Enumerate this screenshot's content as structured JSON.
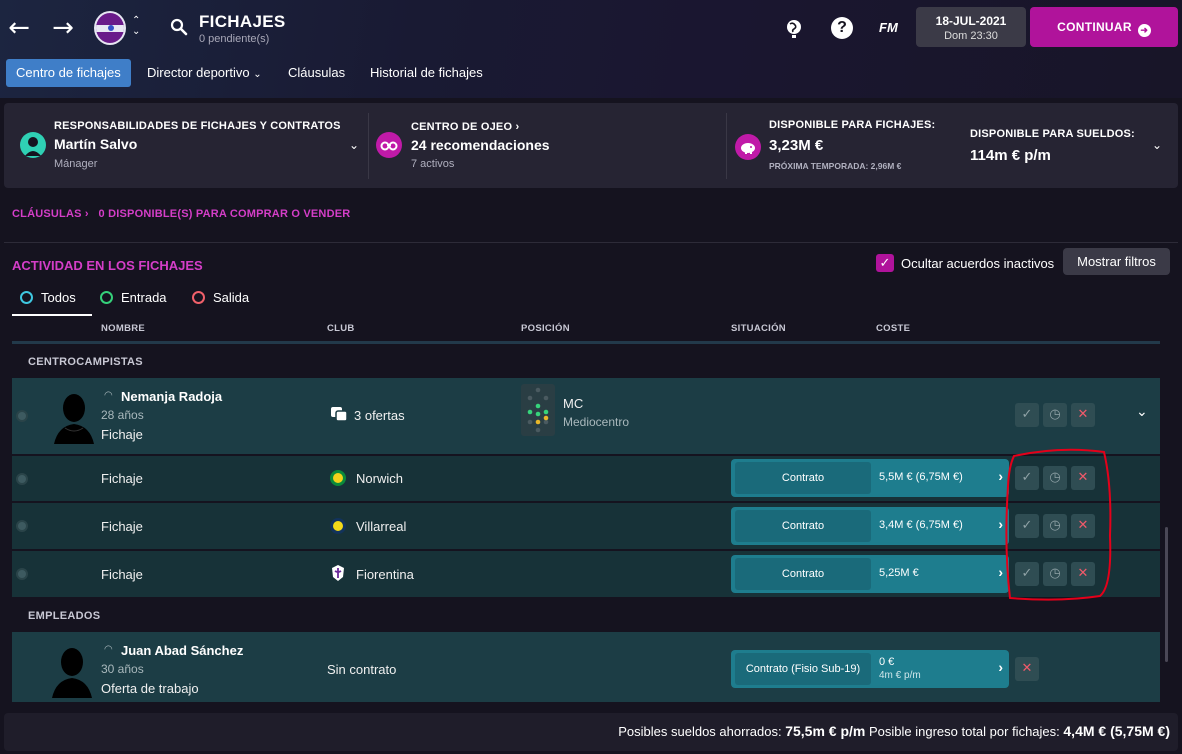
{
  "header": {
    "title": "FICHAJES",
    "subtitle": "0 pendiente(s)",
    "fm_logo": "FM",
    "help": "?",
    "date": "18-JUL-2021",
    "day_time": "Dom 23:30",
    "continue_label": "CONTINUAR"
  },
  "tabs": [
    {
      "label": "Centro de fichajes",
      "active": true
    },
    {
      "label": "Director deportivo"
    },
    {
      "label": "Cláusulas"
    },
    {
      "label": "Historial de fichajes"
    }
  ],
  "summary": {
    "resp_title": "RESPONSABILIDADES DE FICHAJES Y CONTRATOS",
    "resp_name": "Martín Salvo",
    "resp_role": "Mánager",
    "scout_title": "CENTRO DE OJEO",
    "scout_value": "24 recomendaciones",
    "scout_sub": "7 activos",
    "budget_title": "DISPONIBLE PARA FICHAJES:",
    "budget_value": "3,23M €",
    "budget_next": "PRÓXIMA TEMPORADA: 2,96M €",
    "wage_title": "DISPONIBLE PARA SUELDOS:",
    "wage_value": "114m € p/m"
  },
  "clausulas": {
    "link": "CLÁUSULAS",
    "text": "0 DISPONIBLE(S) PARA COMPRAR O VENDER"
  },
  "activity": {
    "title": "ACTIVIDAD EN LOS FICHAJES",
    "hide_inactive_label": "Ocultar acuerdos inactivos",
    "hide_inactive_checked": true,
    "filters_button": "Mostrar filtros",
    "filter_tabs": [
      "Todos",
      "Entrada",
      "Salida"
    ],
    "columns": [
      "NOMBRE",
      "CLUB",
      "POSICIÓN",
      "SITUACIÓN",
      "COSTE"
    ]
  },
  "sections": {
    "midfielders": "CENTROCAMPISTAS",
    "staff": "EMPLEADOS"
  },
  "player": {
    "name": "Nemanja Radoja",
    "age": "28 años",
    "type": "Fichaje",
    "offers": "3 ofertas",
    "pos_code": "MC",
    "pos_name": "Mediocentro"
  },
  "offers": [
    {
      "type": "Fichaje",
      "club": "Norwich",
      "club_color": "#f2d21b",
      "club_accent": "#0b8a3a",
      "contract": "Contrato",
      "cost": "5,5M € (6,75M €)"
    },
    {
      "type": "Fichaje",
      "club": "Villarreal",
      "club_color": "#f3d919",
      "club_accent": "#12335c",
      "contract": "Contrato",
      "cost": "3,4M € (6,75M €)"
    },
    {
      "type": "Fichaje",
      "club": "Fiorentina",
      "club_color": "#6a2a9a",
      "club_accent": "#ffffff",
      "contract": "Contrato",
      "cost": "5,25M €"
    }
  ],
  "staff": {
    "name": "Juan Abad Sánchez",
    "age": "30 años",
    "type": "Oferta de trabajo",
    "club": "Sin contrato",
    "contract": "Contrato (Fisio Sub-19)",
    "cost": "0 €",
    "cost_sub": "4m € p/m"
  },
  "footer": {
    "wages_label": "Posibles sueldos ahorrados:",
    "wages_value": "75,5m € p/m",
    "income_label": "Posible ingreso total por fichajes:",
    "income_value": "4,4M € (5,75M €)"
  },
  "colors": {
    "accent": "#b0139b",
    "magenta_text": "#d53ec8",
    "tab_active": "#3f7ec8",
    "row": "#173238",
    "contract": "#1e7d8e"
  }
}
